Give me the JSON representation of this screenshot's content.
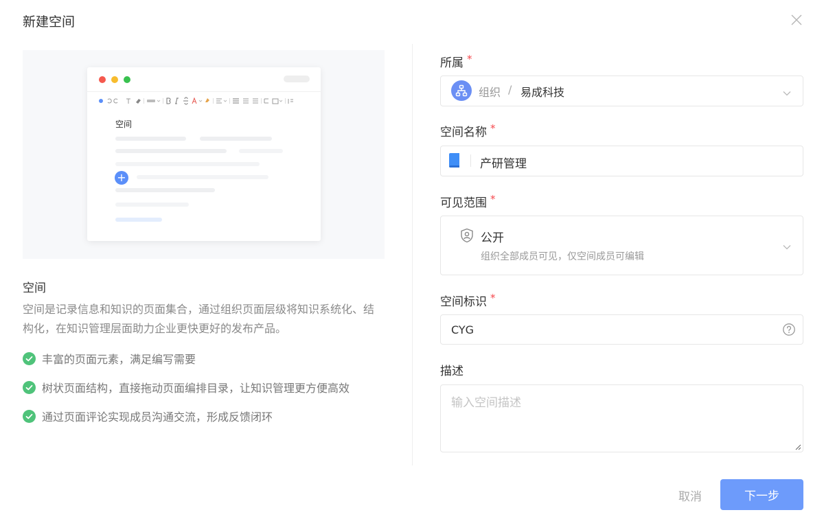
{
  "dialog": {
    "title": "新建空间",
    "cancel_label": "取消",
    "next_label": "下一步"
  },
  "preview": {
    "heading": "空间"
  },
  "info": {
    "title": "空间",
    "description": "空间是记录信息和知识的页面集合，通过组织页面层级将知识系统化、结构化，在知识管理层面助力企业更快更好的发布产品。",
    "features": [
      "丰富的页面元素，满足编写需要",
      "树状页面结构，直接拖动页面编排目录，让知识管理更方便高效",
      "通过页面评论实现成员沟通交流，形成反馈闭环"
    ]
  },
  "form": {
    "belongs": {
      "label": "所属",
      "required_mark": "*",
      "parent": "组织",
      "separator": "/",
      "value": "易成科技"
    },
    "name": {
      "label": "空间名称",
      "required_mark": "*",
      "value": "产研管理"
    },
    "visibility": {
      "label": "可见范围",
      "required_mark": "*",
      "value": "公开",
      "description": "组织全部成员可见，仅空间成员可编辑"
    },
    "key": {
      "label": "空间标识",
      "required_mark": "*",
      "value": "CYG"
    },
    "description": {
      "label": "描述",
      "placeholder": "输入空间描述"
    }
  },
  "colors": {
    "primary_button": "#6d9bfb",
    "required": "#f5484d",
    "check": "#4fc37a",
    "org_icon": "#6b8ff4",
    "book_icon": "#3f8ef7"
  },
  "icons": [
    "close-icon",
    "org-tree-icon",
    "book-icon",
    "shield-user-icon",
    "help-circle-icon",
    "chevron-down-icon",
    "check-circle-icon",
    "plus-icon"
  ]
}
